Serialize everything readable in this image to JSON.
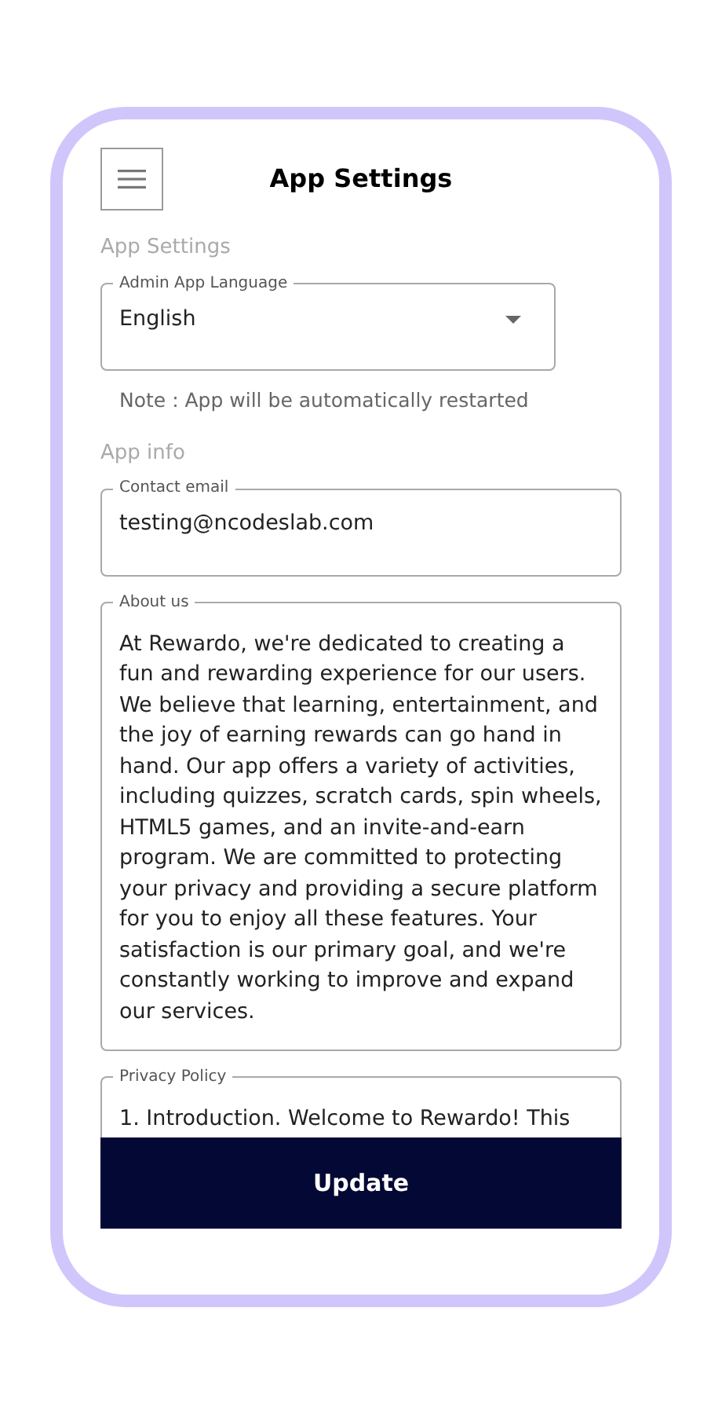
{
  "header": {
    "title": "App Settings"
  },
  "sections": [
    {
      "heading": "App Settings",
      "fields": [
        {
          "kind": "select",
          "label": "Admin App Language",
          "value": "English",
          "note": "Note : App will be automatically restarted"
        }
      ]
    },
    {
      "heading": "App info",
      "fields": [
        {
          "kind": "input",
          "label": "Contact email",
          "value": "testing@ncodeslab.com"
        },
        {
          "kind": "textarea",
          "label": "About us",
          "value": "At Rewardo, we're dedicated to creating a fun and rewarding experience for our users. We believe that learning, entertainment, and the joy of earning rewards can go hand in hand. Our app offers a variety of activities, including quizzes, scratch cards, spin wheels, HTML5 games, and an invite-and-earn program. We are committed to protecting your privacy and providing a secure platform for you to enjoy all these features. Your satisfaction is our primary goal, and we're constantly working to improve and expand our services."
        },
        {
          "kind": "textarea",
          "label": "Privacy Policy",
          "value": "1. Introduction. Welcome to Rewardo! This"
        }
      ]
    }
  ],
  "update_button": "Update"
}
